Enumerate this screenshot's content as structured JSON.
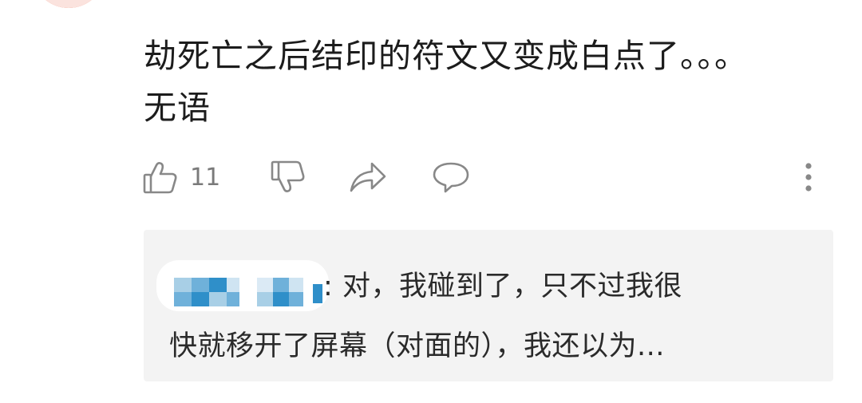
{
  "comment": {
    "lines": [
      "劫死亡之后结印的符文又变成白点了。。。",
      "无语"
    ]
  },
  "actions": {
    "like_count": "11",
    "icons": [
      "thumbs-up-icon",
      "thumbs-down-icon",
      "share-icon",
      "comment-icon",
      "more-vertical-icon"
    ]
  },
  "reply": {
    "author_separator": ":",
    "text_line1": "对，我碰到了，只不过我很",
    "text_line2": "快就移开了屏幕（对面的），我还以为..."
  },
  "colors": {
    "avatar": "#f0674a",
    "icon": "#888888",
    "reply_bg": "#f3f3f3",
    "mosaic_blue": "#2f8fc9"
  }
}
